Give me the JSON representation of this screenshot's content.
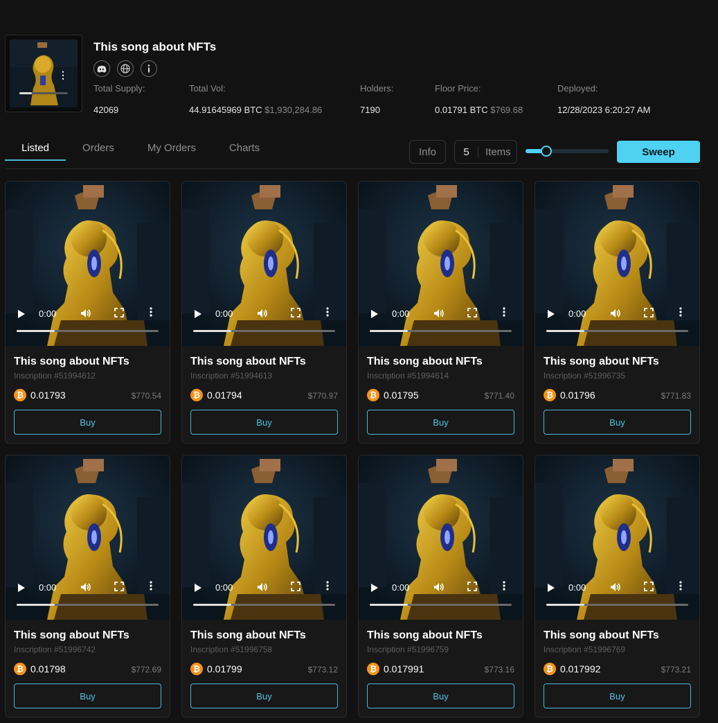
{
  "collection": {
    "title": "This song about NFTs",
    "icons": [
      "discord-icon",
      "globe-icon",
      "info-icon"
    ],
    "thumb_more": "⋮",
    "stats": [
      {
        "label": "Total Supply:",
        "value": "42069",
        "usd": ""
      },
      {
        "label": "Total Vol:",
        "value": "44.91645969 BTC",
        "usd": "$1,930,284.86"
      },
      {
        "label": "Holders:",
        "value": "7190",
        "usd": ""
      },
      {
        "label": "Floor Price:",
        "value": "0.01791 BTC",
        "usd": "$769.68"
      },
      {
        "label": "Deployed:",
        "value": "12/28/2023 6:20:27 AM",
        "usd": ""
      }
    ]
  },
  "tabs": [
    {
      "label": "Listed",
      "active": true
    },
    {
      "label": "Orders",
      "active": false
    },
    {
      "label": "My Orders",
      "active": false
    },
    {
      "label": "Charts",
      "active": false
    }
  ],
  "toolbar": {
    "info_label": "Info",
    "items_count": "5",
    "items_label": "Items",
    "slider_fraction": 0.25,
    "sweep_label": "Sweep"
  },
  "player": {
    "time": "0:00",
    "played_fraction": 0.27
  },
  "cards": [
    {
      "title": "This song about NFTs",
      "inscription": "Inscription #51994612",
      "price": "0.01793",
      "usd": "$770.54",
      "buy": "Buy"
    },
    {
      "title": "This song about NFTs",
      "inscription": "Inscription #51994613",
      "price": "0.01794",
      "usd": "$770.97",
      "buy": "Buy"
    },
    {
      "title": "This song about NFTs",
      "inscription": "Inscription #51994614",
      "price": "0.01795",
      "usd": "$771.40",
      "buy": "Buy"
    },
    {
      "title": "This song about NFTs",
      "inscription": "Inscription #51996735",
      "price": "0.01796",
      "usd": "$771.83",
      "buy": "Buy"
    },
    {
      "title": "This song about NFTs",
      "inscription": "Inscription #51996742",
      "price": "0.01798",
      "usd": "$772.69",
      "buy": "Buy"
    },
    {
      "title": "This song about NFTs",
      "inscription": "Inscription #51996758",
      "price": "0.01799",
      "usd": "$773.12",
      "buy": "Buy"
    },
    {
      "title": "This song about NFTs",
      "inscription": "Inscription #51996759",
      "price": "0.017991",
      "usd": "$773.16",
      "buy": "Buy"
    },
    {
      "title": "This song about NFTs",
      "inscription": "Inscription #51996769",
      "price": "0.017992",
      "usd": "$773.21",
      "buy": "Buy"
    }
  ],
  "colors": {
    "accent": "#4fd2f2",
    "btc": "#f7931a",
    "background": "#121212",
    "card": "#181818"
  }
}
